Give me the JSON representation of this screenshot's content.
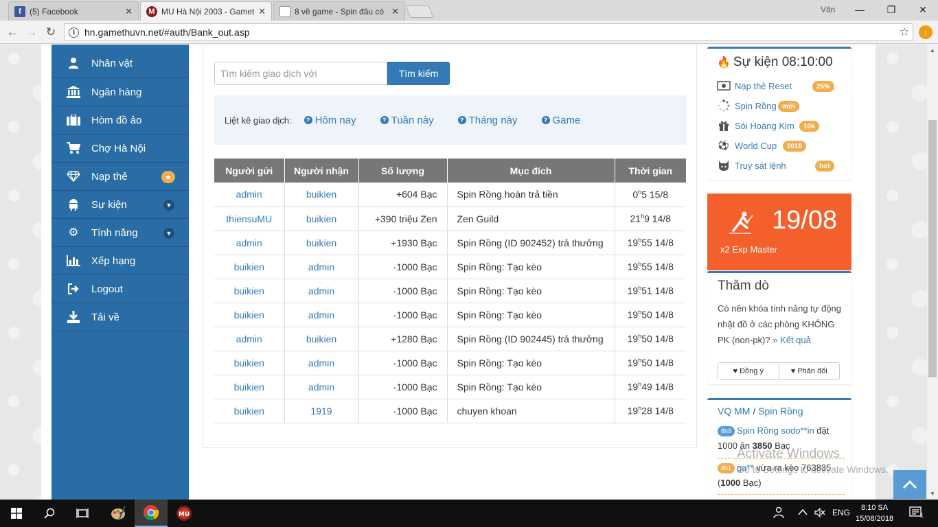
{
  "browser": {
    "tabs": [
      {
        "title": "(5) Facebook",
        "icon": "facebook-icon",
        "icon_color": "#3b5998"
      },
      {
        "title": "MU Hà Nội 2003 - Gamet",
        "icon": "mu-game-icon",
        "icon_color": "#8b1a1a"
      },
      {
        "title": "8 về game - Spin đầu có",
        "icon": "page-icon",
        "icon_color": "#ffffff"
      }
    ],
    "user": "Văn",
    "url": "hn.gamethuvn.net/#auth/Bank_out.asp"
  },
  "sidebar": {
    "items": [
      {
        "label": "Nhân vật",
        "icon": "user-icon"
      },
      {
        "label": "Ngân hàng",
        "icon": "bank-icon"
      },
      {
        "label": "Hòm đồ ảo",
        "icon": "suitcase-icon"
      },
      {
        "label": "Chợ Hà Nội",
        "icon": "cart-icon"
      },
      {
        "label": "Nạp thẻ",
        "icon": "diamond-icon",
        "badge": "★"
      },
      {
        "label": "Sự kiện",
        "icon": "android-icon",
        "dropdown": true
      },
      {
        "label": "Tính năng",
        "icon": "cogs-icon",
        "dropdown": true
      },
      {
        "label": "Xếp hạng",
        "icon": "bar-chart-icon"
      },
      {
        "label": "Logout",
        "icon": "logout-icon"
      },
      {
        "label": "Tải về",
        "icon": "download-icon"
      }
    ]
  },
  "search": {
    "placeholder": "Tìm kiếm giao dịch với",
    "button": "Tìm kiếm"
  },
  "filters": {
    "label": "Liệt kê giao dịch:",
    "links": [
      "Hôm nay",
      "Tuần này",
      "Tháng này",
      "Game"
    ]
  },
  "table": {
    "headers": [
      "Người gửi",
      "Người nhận",
      "Số lượng",
      "Mục đích",
      "Thời gian"
    ],
    "rows": [
      {
        "from": "admin",
        "to": "buikien",
        "amount": "+604  Bạc",
        "purpose": "Spin Rồng hoàn trả tiền",
        "hour": "0",
        "min": "5 15/8"
      },
      {
        "from": "thiensuMU",
        "to": "buikien",
        "amount": "+390  triệu Zen",
        "purpose": "Zen Guild",
        "hour": "21",
        "min": "9 14/8"
      },
      {
        "from": "admin",
        "to": "buikien",
        "amount": "+1930  Bạc",
        "purpose": "Spin Rồng (ID 902452) trả thưởng",
        "hour": "19",
        "min": "55 14/8"
      },
      {
        "from": "buikien",
        "to": "admin",
        "amount": "-1000  Bạc",
        "purpose": "Spin Rồng: Tạo kèo",
        "hour": "19",
        "min": "55 14/8"
      },
      {
        "from": "buikien",
        "to": "admin",
        "amount": "-1000  Bạc",
        "purpose": "Spin Rồng: Tạo kèo",
        "hour": "19",
        "min": "51 14/8"
      },
      {
        "from": "buikien",
        "to": "admin",
        "amount": "-1000  Bạc",
        "purpose": "Spin Rồng: Tạo kèo",
        "hour": "19",
        "min": "50 14/8"
      },
      {
        "from": "admin",
        "to": "buikien",
        "amount": "+1280  Bạc",
        "purpose": "Spin Rồng (ID 902445) trả thưởng",
        "hour": "19",
        "min": "50 14/8"
      },
      {
        "from": "buikien",
        "to": "admin",
        "amount": "-1000  Bạc",
        "purpose": "Spin Rồng: Tạo kèo",
        "hour": "19",
        "min": "50 14/8"
      },
      {
        "from": "buikien",
        "to": "admin",
        "amount": "-1000  Bạc",
        "purpose": "Spin Rồng: Tạo kèo",
        "hour": "19",
        "min": "49 14/8"
      },
      {
        "from": "buikien",
        "to": "1919",
        "amount": "-1000  Bạc",
        "purpose": "chuyen khoan",
        "hour": "19",
        "min": "28 14/8"
      }
    ],
    "hour_mark": "h"
  },
  "events": {
    "title": "Sự kiện 08:10:00",
    "items": [
      {
        "label": "Nạp thẻ Reset",
        "badge": "25%",
        "icon": "money-icon"
      },
      {
        "label": "Spin Rồng",
        "badge": "mới",
        "icon": "spinner-icon"
      },
      {
        "label": "Sói Hoàng Kim",
        "badge": "10k",
        "icon": "gift-icon"
      },
      {
        "label": "World Cup",
        "badge": "2018",
        "icon": "soccer-ball-icon"
      },
      {
        "label": "Truy sát lệnh",
        "badge": "hot",
        "icon": "github-cat-icon"
      }
    ]
  },
  "promo": {
    "date": "19/08",
    "subtitle": "x2 Exp Master"
  },
  "poll": {
    "title": "Thăm dò",
    "question": "Có nên khóa tính năng tự động nhặt đồ ở các phòng KHÔNG PK (non-pk)?",
    "result_link": "» Kết quả",
    "agree": "Đồng ý",
    "disagree": "Phản đối"
  },
  "vq": {
    "title_a": "VQ MM",
    "title_sep": " / ",
    "title_b": "Spin Rồng",
    "entries": [
      {
        "time": "8h9",
        "time_color": "#5b9bd5",
        "link": "Spin Rồng sodo**in",
        "pre": " đặt 1000 ăn ",
        "bold": "3850",
        "post": " Bạc"
      },
      {
        "time": "8h1",
        "time_color": "#f0ad4e",
        "link": "ga**",
        "pre": " vừa ra kèo 763835 (",
        "bold": "1000",
        "post": " Bạc)"
      }
    ]
  },
  "watermark": {
    "line1": "Activate Windows",
    "line2": "Go to Settings to activate Windows."
  },
  "taskbar": {
    "lang": "ENG",
    "time": "8:10 SA",
    "date": "15/08/2018",
    "notif_count": "1"
  }
}
